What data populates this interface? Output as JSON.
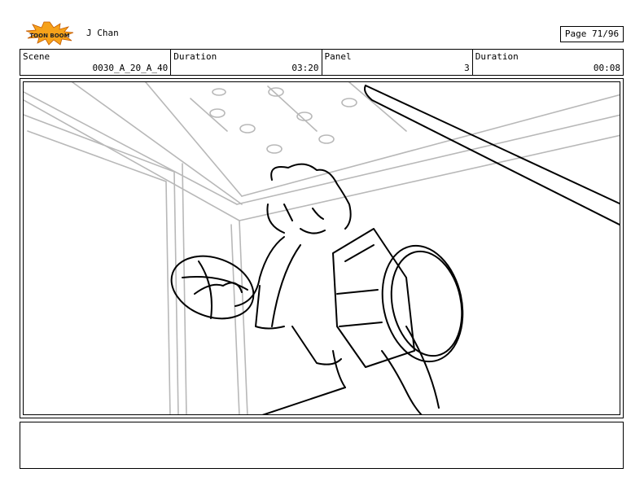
{
  "header": {
    "project": "J Chan",
    "page_label": "Page 71/96",
    "logo_text": "TOON BOOM"
  },
  "fields": [
    {
      "label": "Scene",
      "value": "0030_A_20_A_40"
    },
    {
      "label": "Duration",
      "value": "03:20"
    },
    {
      "label": "Panel",
      "value": "3"
    },
    {
      "label": "Duration",
      "value": "00:08"
    }
  ],
  "notes": {
    "text": ""
  }
}
